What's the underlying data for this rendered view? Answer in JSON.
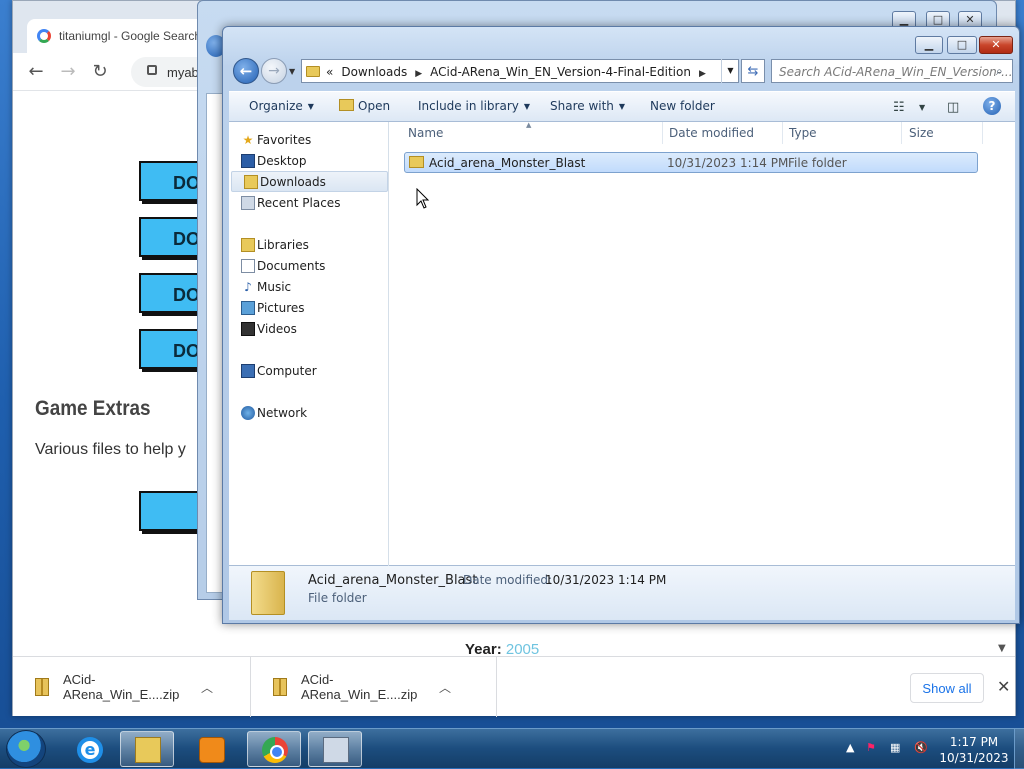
{
  "chrome": {
    "tab_title": "titaniumgl - Google Search",
    "url": "myaba",
    "download_button_label": "DOWNLOAD",
    "section_heading": "Game Extras",
    "section_text": "Various files to help y",
    "year_label": "Year:",
    "year_value": "2005",
    "downloads": [
      {
        "name": "ACid-ARena_Win_E....zip"
      },
      {
        "name": "ACid-ARena_Win_E....zip"
      }
    ],
    "show_all": "Show all"
  },
  "explorer": {
    "breadcrumb": [
      "Downloads",
      "ACid-ARena_Win_EN_Version-4-Final-Edition"
    ],
    "breadcrumb_prefix": "«",
    "search_placeholder": "Search ACid-ARena_Win_EN_Version-...",
    "commands": {
      "organize": "Organize",
      "open": "Open",
      "include_in_library": "Include in library",
      "share_with": "Share with",
      "new_folder": "New folder"
    },
    "nav": {
      "favorites": "Favorites",
      "desktop": "Desktop",
      "downloads": "Downloads",
      "recent_places": "Recent Places",
      "libraries": "Libraries",
      "documents": "Documents",
      "music": "Music",
      "pictures": "Pictures",
      "videos": "Videos",
      "computer": "Computer",
      "network": "Network"
    },
    "columns": {
      "name": "Name",
      "date_modified": "Date modified",
      "type": "Type",
      "size": "Size"
    },
    "files": [
      {
        "name": "Acid_arena_Monster_Blast",
        "date_modified": "10/31/2023 1:14 PM",
        "type": "File folder",
        "size": ""
      }
    ],
    "details": {
      "name": "Acid_arena_Monster_Blast",
      "date_label": "Date modified:",
      "date_value": "10/31/2023 1:14 PM",
      "type": "File folder"
    }
  },
  "taskbar": {
    "time": "1:17 PM",
    "date": "10/31/2023",
    "apps": [
      "internet-explorer-icon",
      "windows-explorer-icon",
      "media-player-icon",
      "chrome-icon",
      "remote-desktop-icon"
    ]
  },
  "colors": {
    "accent_download": "#3fbcf3",
    "selection": "#c1dbfc",
    "year": "#6fc4e0"
  }
}
